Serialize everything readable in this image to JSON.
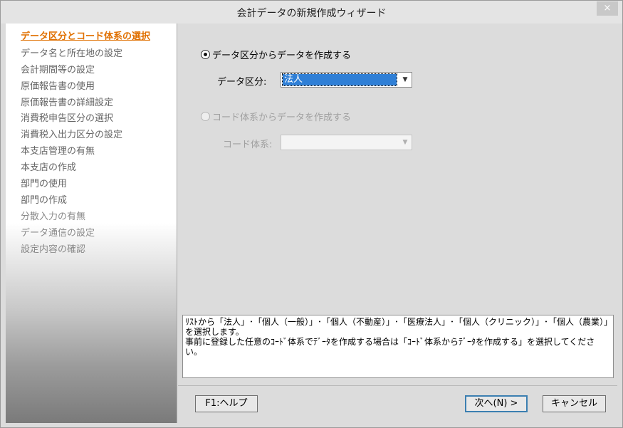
{
  "window": {
    "title": "会計データの新規作成ウィザード",
    "close_label": "×"
  },
  "sidebar": {
    "items": [
      {
        "label": "データ区分とコード体系の選択"
      },
      {
        "label": "データ名と所在地の設定"
      },
      {
        "label": "会計期間等の設定"
      },
      {
        "label": "原価報告書の使用"
      },
      {
        "label": "原価報告書の詳細設定"
      },
      {
        "label": "消費税申告区分の選択"
      },
      {
        "label": "消費税入出力区分の設定"
      },
      {
        "label": "本支店管理の有無"
      },
      {
        "label": "本支店の作成"
      },
      {
        "label": "部門の使用"
      },
      {
        "label": "部門の作成"
      },
      {
        "label": "分散入力の有無"
      },
      {
        "label": "データ通信の設定"
      },
      {
        "label": "設定内容の確認"
      }
    ]
  },
  "form": {
    "option_category": {
      "label": "データ区分からデータを作成する",
      "checked": true
    },
    "category_field": {
      "label": "データ区分:",
      "value": "法人"
    },
    "option_code": {
      "label": "コード体系からデータを作成する",
      "checked": false
    },
    "code_field": {
      "label": "コード体系:",
      "value": ""
    }
  },
  "description": {
    "lines": [
      "ﾘｽﾄから「法人」･「個人（一般）」･「個人（不動産）」･「医療法人」･「個人（クリニック）」･「個人（農業）」を選択します。",
      "事前に登録した任意のｺｰﾄﾞ体系でﾃﾞｰﾀを作成する場合は「ｺｰﾄﾞ体系からﾃﾞｰﾀを作成する」を選択してください。"
    ]
  },
  "buttons": {
    "help": "F1:ヘルプ",
    "next": "次へ(N) >",
    "cancel": "キャンセル"
  },
  "icons": {
    "dropdown": "chevron-down-icon"
  }
}
